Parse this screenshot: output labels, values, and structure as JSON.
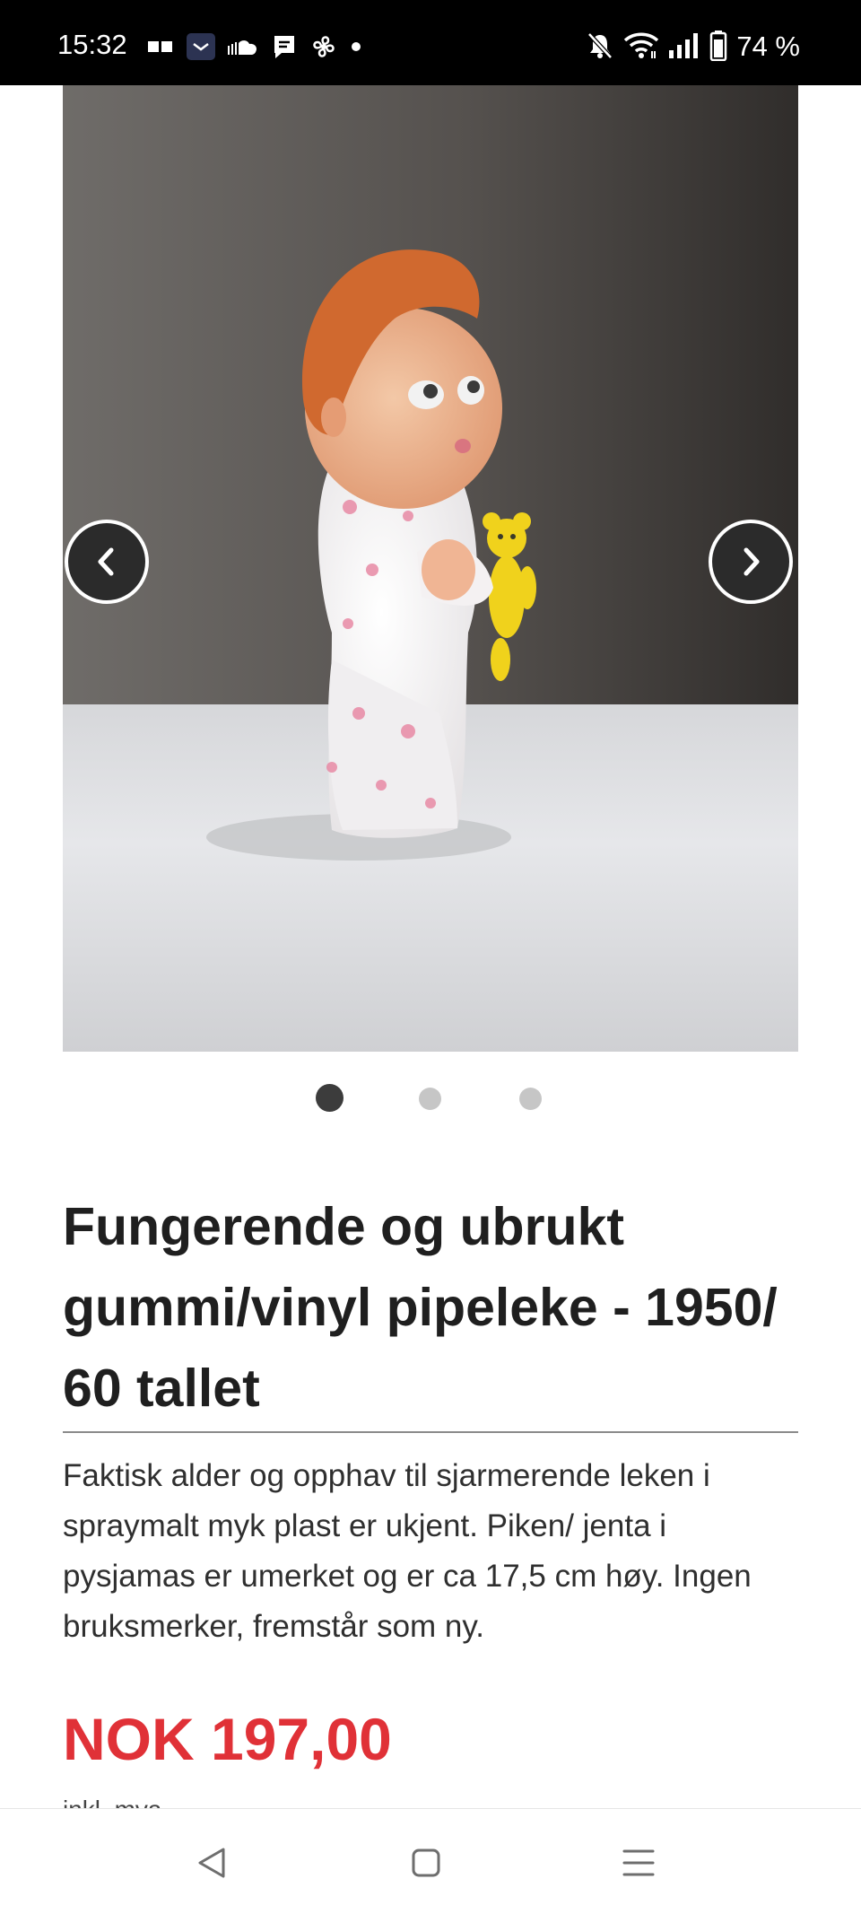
{
  "status_bar": {
    "time": "15:32",
    "battery": "74 %",
    "left_icons": [
      "notification-book-icon",
      "email-app-icon",
      "cloud-icon",
      "chat-bubble-icon",
      "pinwheel-icon",
      "more-dot-icon"
    ],
    "right_icons": [
      "mute-icon",
      "wifi-icon",
      "signal-icon",
      "battery-icon"
    ]
  },
  "carousel": {
    "image_alt": "Gummi/vinyl pipeleke - baby i pysjamas med gul bamse",
    "prev_icon": "chevron-left-icon",
    "next_icon": "chevron-right-icon",
    "total_slides": 3,
    "active_slide": 1
  },
  "product": {
    "title": "Fungerende og ubrukt gummi/vinyl pipeleke - 1950/ 60 tallet",
    "description": "Faktisk alder og opphav til sjarmerende leken i spraymalt myk plast er ukjent. Piken/ jenta i pysjamas er umerket og er ca 17,5 cm høy. Ingen bruksmerker, fremstår som ny.",
    "price": "NOK 197,00",
    "price_note": "inkl. mva"
  },
  "nav_bar": {
    "back_icon": "back-triangle-icon",
    "home_icon": "home-square-icon",
    "recents_icon": "recents-menu-icon"
  },
  "colors": {
    "status_bar_bg": "#000000",
    "title_text": "#1f1f1f",
    "body_text": "#2f2f2f",
    "price": "#e03137",
    "dot_active": "#3c3c3c",
    "dot_inactive": "#c6c6c6",
    "arrow_bg": "#2b2b2b"
  }
}
